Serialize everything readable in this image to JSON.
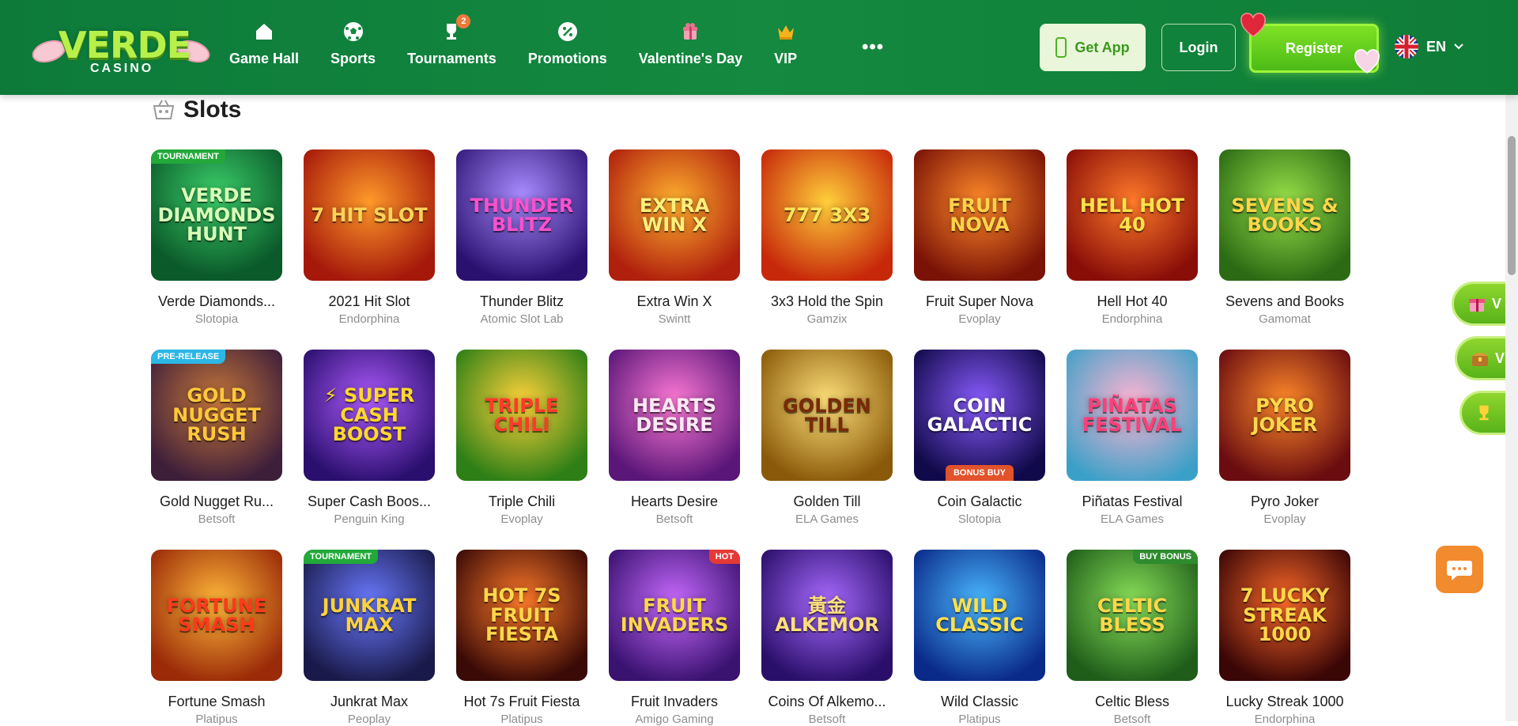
{
  "brand": {
    "name": "VERDE",
    "sub": "CASINO"
  },
  "nav": [
    {
      "id": "game-hall",
      "label": "Game Hall",
      "icon": "home-icon"
    },
    {
      "id": "sports",
      "label": "Sports",
      "icon": "soccer-ball-icon"
    },
    {
      "id": "tournaments",
      "label": "Tournaments",
      "icon": "trophy-icon",
      "badge": "2"
    },
    {
      "id": "promotions",
      "label": "Promotions",
      "icon": "percent-icon"
    },
    {
      "id": "valentines-day",
      "label": "Valentine's Day",
      "icon": "gift-icon"
    },
    {
      "id": "vip",
      "label": "VIP",
      "icon": "crown-icon"
    }
  ],
  "header": {
    "more": "•••",
    "get_app": "Get App",
    "login": "Login",
    "register": "Register",
    "language": "EN"
  },
  "section": {
    "title": "Slots",
    "icon": "slots-basket-icon"
  },
  "games": [
    {
      "name": "Verde Diamonds...",
      "provider": "Slotopia",
      "art": "Verde Diamonds Hunt",
      "tag": "TOURNAMENT",
      "tagColor": "#22a93a",
      "bg": "radial-gradient(circle at 50% 35%, #3bd06a, #0b5a2a 75%)",
      "fg": "#d8ffb8"
    },
    {
      "name": "2021 Hit Slot",
      "provider": "Endorphina",
      "art": "7 Hit Slot",
      "bg": "radial-gradient(circle at 50% 40%, #ff9a2a, #a5180a 80%)",
      "fg": "#ffd35a"
    },
    {
      "name": "Thunder Blitz",
      "provider": "Atomic Slot Lab",
      "art": "Thunder Blitz",
      "bg": "radial-gradient(circle at 50% 35%, #a98bff, #2a1170 80%)",
      "fg": "#ff4fcf"
    },
    {
      "name": "Extra Win X",
      "provider": "Swintt",
      "art": "Extra Win X",
      "bg": "radial-gradient(circle at 50% 40%, #ffb02e, #b0200d 80%)",
      "fg": "#fff07a"
    },
    {
      "name": "3x3 Hold the Spin",
      "provider": "Gamzix",
      "art": "777 3x3",
      "bg": "radial-gradient(circle at 50% 40%, #ffcf3a, #c7280a 80%)",
      "fg": "#ffe65a"
    },
    {
      "name": "Fruit Super Nova",
      "provider": "Evoplay",
      "art": "Fruit Nova",
      "bg": "radial-gradient(circle at 50% 40%, #ff8a2a, #7a1206 80%)",
      "fg": "#ffd24a"
    },
    {
      "name": "Hell Hot 40",
      "provider": "Endorphina",
      "art": "Hell Hot 40",
      "bg": "radial-gradient(circle at 50% 40%, #ff7a2a, #8a0e08 80%)",
      "fg": "#ffe14a"
    },
    {
      "name": "Sevens and Books",
      "provider": "Gamomat",
      "art": "Sevens & Books",
      "bg": "radial-gradient(circle at 50% 40%, #9ae24a, #2c6b14 80%)",
      "fg": "#ffd64a"
    },
    {
      "name": "Gold Nugget Ru...",
      "provider": "Betsoft",
      "art": "Gold Nugget Rush",
      "tag": "PRE-RELEASE",
      "tagColor": "#2cb7e6",
      "bg": "radial-gradient(circle at 50% 40%, #c8783a, #3e1f3a 80%)",
      "fg": "#ffc83a"
    },
    {
      "name": "Super Cash Boos...",
      "provider": "Penguin King",
      "art": "⚡ Super Cash Boost",
      "bg": "radial-gradient(circle at 50% 40%, #b05cff, #2a0f6e 80%)",
      "fg": "#ffd82a"
    },
    {
      "name": "Triple Chili",
      "provider": "Evoplay",
      "art": "Triple Chili",
      "bg": "radial-gradient(circle at 50% 40%, #ffd23a, #2d7f16 80%)",
      "fg": "#ff3b2a"
    },
    {
      "name": "Hearts Desire",
      "provider": "Betsoft",
      "art": "Hearts Desire",
      "bg": "radial-gradient(circle at 50% 40%, #ff7ad6, #5a1678 80%)",
      "fg": "#ffe8f6"
    },
    {
      "name": "Golden Till",
      "provider": "ELA Games",
      "art": "Golden Till",
      "bg": "radial-gradient(circle at 50% 40%, #ffe07a, #8a5a0a 80%)",
      "fg": "#7a2a06"
    },
    {
      "name": "Coin Galactic",
      "provider": "Slotopia",
      "art": "Coin Galactic",
      "tagBottom": "BONUS BUY",
      "bg": "radial-gradient(circle at 50% 40%, #8a5cff, #110a4a 80%)",
      "fg": "#ffffff"
    },
    {
      "name": "Piñatas Festival",
      "provider": "ELA Games",
      "art": "Piñatas Festival",
      "bg": "radial-gradient(circle at 50% 40%, #ffb4d2, #3aa0c8 85%)",
      "fg": "#ff3f7a"
    },
    {
      "name": "Pyro Joker",
      "provider": "Evoplay",
      "art": "Pyro Joker",
      "bg": "radial-gradient(circle at 50% 40%, #ff8a2a, #6a0c10 80%)",
      "fg": "#ffd84a"
    },
    {
      "name": "Fortune Smash",
      "provider": "Platipus",
      "art": "Fortune Smash",
      "bg": "radial-gradient(circle at 50% 40%, #ffb83a, #9a2a08 80%)",
      "fg": "#ff3a1a"
    },
    {
      "name": "Junkrat Max",
      "provider": "Peoplay",
      "art": "Junkrat Max",
      "tag": "TOURNAMENT",
      "tagColor": "#22a93a",
      "bg": "radial-gradient(circle at 50% 40%, #6a7aff, #1a1a4a 80%)",
      "fg": "#ffd23a"
    },
    {
      "name": "Hot 7s Fruit Fiesta",
      "provider": "Platipus",
      "art": "Hot 7s Fruit Fiesta",
      "bg": "radial-gradient(circle at 50% 40%, #ff7a2a, #3a0a06 80%)",
      "fg": "#ffd84a"
    },
    {
      "name": "Fruit Invaders",
      "provider": "Amigo Gaming",
      "art": "Fruit Invaders",
      "tag": "HOT",
      "tagColor": "#e53935",
      "tagRight": true,
      "bg": "radial-gradient(circle at 50% 40%, #c86aff, #3a1270 80%)",
      "fg": "#ffd84a"
    },
    {
      "name": "Coins Of Alkemo...",
      "provider": "Betsoft",
      "art": "黃金 Alkemor",
      "bg": "radial-gradient(circle at 50% 40%, #a86aff, #2a0f6a 80%)",
      "fg": "#ffe07a"
    },
    {
      "name": "Wild Classic",
      "provider": "Platipus",
      "art": "Wild Classic",
      "bg": "radial-gradient(circle at 50% 40%, #4ab8ff, #0a2a8a 80%)",
      "fg": "#ffe04a"
    },
    {
      "name": "Celtic Bless",
      "provider": "Betsoft",
      "art": "Celtic Bless",
      "tag": "BUY BONUS",
      "tagColor": "#2e8b2e",
      "tagRight": true,
      "bg": "radial-gradient(circle at 50% 40%, #8ae05a, #1f5e1a 80%)",
      "fg": "#ffd84a"
    },
    {
      "name": "Lucky Streak 1000",
      "provider": "Endorphina",
      "art": "7 Lucky Streak 1000",
      "bg": "radial-gradient(circle at 50% 40%, #ff6a2a, #3a0606 80%)",
      "fg": "#ffd84a"
    }
  ],
  "side": {
    "gift_label": "V",
    "chest_label": "V"
  }
}
